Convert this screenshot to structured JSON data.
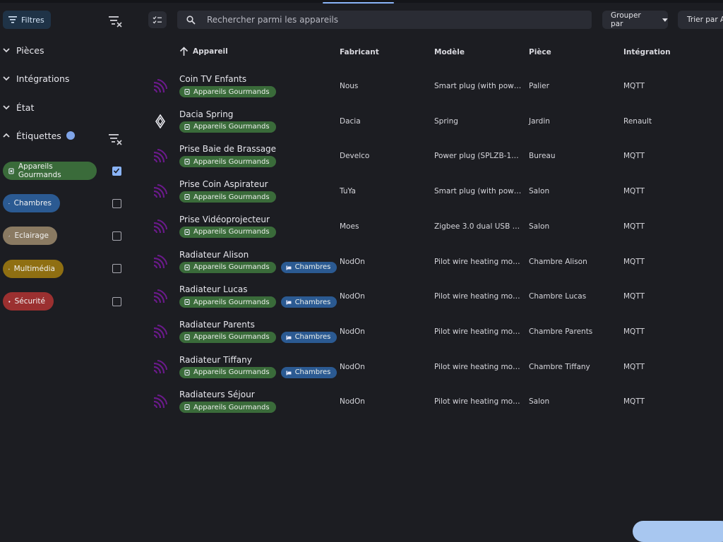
{
  "sidebar": {
    "filters_label": "Filtres",
    "sections": [
      {
        "label": "Pièces"
      },
      {
        "label": "Intégrations"
      },
      {
        "label": "État"
      },
      {
        "label": "Étiquettes"
      }
    ],
    "labels": [
      {
        "name": "Appareils Gourmands",
        "color": "#3a6b3a",
        "checked": true
      },
      {
        "name": "Chambres",
        "color": "#2b5a92",
        "checked": false
      },
      {
        "name": "Eclairage",
        "color": "#8a7a62",
        "checked": false
      },
      {
        "name": "Multimédia",
        "color": "#8f6f12",
        "checked": false
      },
      {
        "name": "Sécurité",
        "color": "#9b3030",
        "checked": false
      }
    ]
  },
  "toolbar": {
    "search_placeholder": "Rechercher parmi les appareils",
    "group_label": "Grouper par",
    "sort_label": "Trier par Ap"
  },
  "table": {
    "headers": {
      "device": "Appareil",
      "manufacturer": "Fabricant",
      "model": "Modèle",
      "room": "Pièce",
      "integration": "Intégration"
    },
    "rows": [
      {
        "name": "Coin TV Enfants",
        "tags": [
          "Appareils Gourmands"
        ],
        "manufacturer": "Nous",
        "model": "Smart plug (with pow…",
        "room": "Palier",
        "integration": "MQTT",
        "icon": "mqtt-icon"
      },
      {
        "name": "Dacia Spring",
        "tags": [
          "Appareils Gourmands"
        ],
        "manufacturer": "Dacia",
        "model": "Spring",
        "room": "Jardin",
        "integration": "Renault",
        "icon": "renault-icon"
      },
      {
        "name": "Prise Baie de Brassage",
        "tags": [
          "Appareils Gourmands"
        ],
        "manufacturer": "Develco",
        "model": "Power plug (SPLZB-1…",
        "room": "Bureau",
        "integration": "MQTT",
        "icon": "mqtt-icon"
      },
      {
        "name": "Prise Coin Aspirateur",
        "tags": [
          "Appareils Gourmands"
        ],
        "manufacturer": "TuYa",
        "model": "Smart plug (with pow…",
        "room": "Salon",
        "integration": "MQTT",
        "icon": "mqtt-icon"
      },
      {
        "name": "Prise Vidéoprojecteur",
        "tags": [
          "Appareils Gourmands"
        ],
        "manufacturer": "Moes",
        "model": "Zigbee 3.0 dual USB …",
        "room": "Salon",
        "integration": "MQTT",
        "icon": "mqtt-icon"
      },
      {
        "name": "Radiateur Alison",
        "tags": [
          "Appareils Gourmands",
          "Chambres"
        ],
        "manufacturer": "NodOn",
        "model": "Pilot wire heating mo…",
        "room": "Chambre Alison",
        "integration": "MQTT",
        "icon": "mqtt-icon"
      },
      {
        "name": "Radiateur Lucas",
        "tags": [
          "Appareils Gourmands",
          "Chambres"
        ],
        "manufacturer": "NodOn",
        "model": "Pilot wire heating mo…",
        "room": "Chambre Lucas",
        "integration": "MQTT",
        "icon": "mqtt-icon"
      },
      {
        "name": "Radiateur Parents",
        "tags": [
          "Appareils Gourmands",
          "Chambres"
        ],
        "manufacturer": "NodOn",
        "model": "Pilot wire heating mo…",
        "room": "Chambre Parents",
        "integration": "MQTT",
        "icon": "mqtt-icon"
      },
      {
        "name": "Radiateur Tiffany",
        "tags": [
          "Appareils Gourmands",
          "Chambres"
        ],
        "manufacturer": "NodOn",
        "model": "Pilot wire heating mo…",
        "room": "Chambre Tiffany",
        "integration": "MQTT",
        "icon": "mqtt-icon"
      },
      {
        "name": "Radiateurs Séjour",
        "tags": [
          "Appareils Gourmands"
        ],
        "manufacturer": "NodOn",
        "model": "Pilot wire heating mo…",
        "room": "Salon",
        "integration": "MQTT",
        "icon": "mqtt-icon"
      }
    ]
  }
}
